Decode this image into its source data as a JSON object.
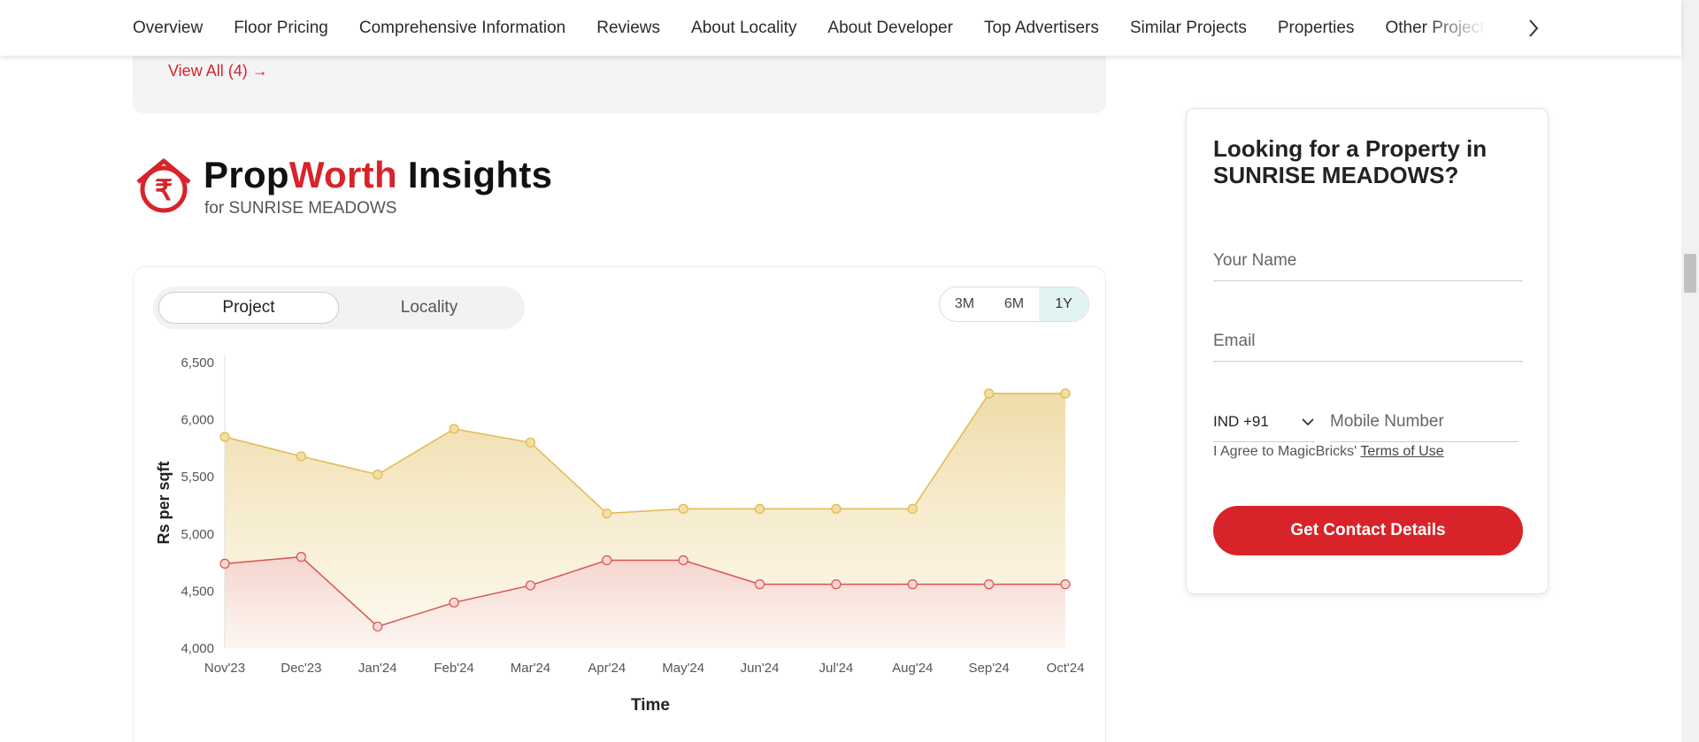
{
  "nav": {
    "items": [
      "Overview",
      "Floor Pricing",
      "Comprehensive Information",
      "Reviews",
      "About Locality",
      "About Developer",
      "Top Advertisers",
      "Similar Projects",
      "Properties",
      "Other Projects"
    ]
  },
  "reviews_panel": {
    "view_all": "View All (4) →"
  },
  "heading": {
    "title_part1": "Prop",
    "title_part2": "Worth",
    "title_part3": " Insights",
    "subtitle": "for SUNRISE MEADOWS"
  },
  "tabs": {
    "project": "Project",
    "locality": "Locality"
  },
  "ranges": [
    "3M",
    "6M",
    "1Y"
  ],
  "contact": {
    "title": "Looking for a Property in SUNRISE MEADOWS?",
    "name_placeholder": "Your Name",
    "email_placeholder": "Email",
    "country_code": "IND +91",
    "mobile_placeholder": "Mobile Number",
    "agree_text": "I Agree to MagicBricks' ",
    "terms_link": "Terms of Use",
    "button": "Get Contact Details"
  },
  "colors": {
    "brand_red": "#d8232a",
    "gold_line": "#e3b84d",
    "red_line": "#d9534f"
  },
  "chart_data": {
    "type": "area",
    "categories": [
      "Nov'23",
      "Dec'23",
      "Jan'24",
      "Feb'24",
      "Mar'24",
      "Apr'24",
      "May'24",
      "Jun'24",
      "Jul'24",
      "Aug'24",
      "Sep'24",
      "Oct'24"
    ],
    "series": [
      {
        "values": [
          5850,
          5680,
          5520,
          5920,
          5800,
          5180,
          5220,
          5220,
          5220,
          5220,
          6230,
          6230
        ]
      },
      {
        "values": [
          4740,
          4800,
          4190,
          4400,
          4550,
          4770,
          4770,
          4560,
          4560,
          4560,
          4560,
          4560
        ]
      }
    ],
    "yticks": [
      "6,500",
      "6,000",
      "5,500",
      "5,000",
      "4,500",
      "4,000"
    ],
    "ylim": [
      4000,
      6500
    ],
    "xlabel": "Time",
    "ylabel": "Rs per sqft",
    "grid": false
  }
}
